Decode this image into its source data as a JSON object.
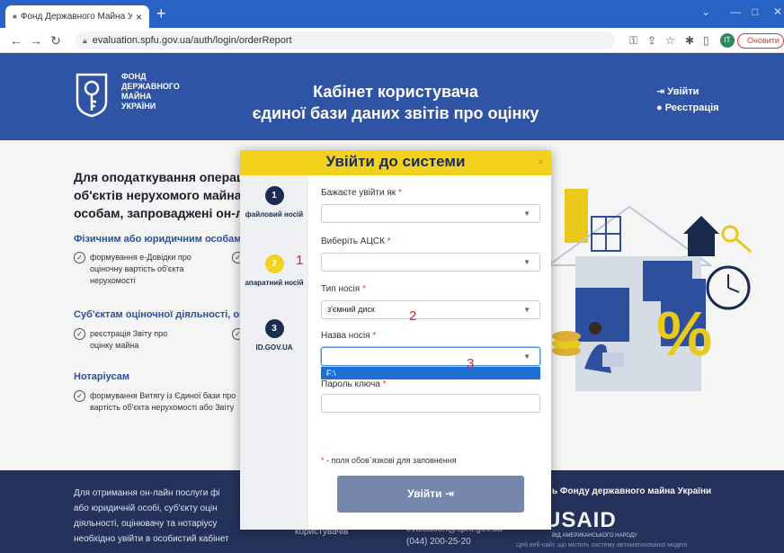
{
  "browser": {
    "tab_title": "Фонд Державного Майна Украї",
    "url": "evaluation.spfu.gov.ua/auth/login/orderReport",
    "profile_initial": "IT",
    "update_label": "Оновити"
  },
  "header": {
    "logo_lines": [
      "ФОНД",
      "ДЕРЖАВНОГО",
      "МАЙНА",
      "УКРАЇНИ"
    ],
    "title_line1": "Кабінет користувача",
    "title_line2": "єдиної бази даних звітів про оцінку",
    "login_label": "Увійти",
    "register_label": "Реєстрація"
  },
  "main": {
    "heading_line1": "Для оподаткування операці",
    "heading_line2": "об'єктів нерухомого майна,",
    "heading_line3": "особам, запроваджені он-ла",
    "section1_title": "Фізичним або юридичним особам",
    "section1_item1": [
      "формування е-Довідки про",
      "оціночну вартість об'єкта",
      "нерухомості"
    ],
    "section2_title": "Суб'єктам оціночної діяльності, оці",
    "section2_item1": [
      "реєстрація Звіту про",
      "оцінку майна"
    ],
    "section3_title": "Нотаріусам",
    "section3_item1": [
      "формування Витягу із Єдиної бази про",
      "вартість об'єкта нерухомості або Звіту"
    ]
  },
  "footer": {
    "text_lines": [
      "Для отримання он-лайн послуги фі",
      "або юридичній особі, суб'єкту оцін",
      "діяльності, оцінювачу та нотаріусу",
      "необхідно увійти в особистий кабінет"
    ],
    "mid_text": "користувачів",
    "email": "evaluation@spfu.gov.ua",
    "phone": "(044) 200-25-20",
    "right_title": "ь Фонду державного майна України",
    "usaid": "USAID",
    "usaid_sub": "ВІД АМЕРИКАНСЬКОГО НАРОДУ",
    "note": "Цей веб-сайт, що містить систему автоматизованої моделі"
  },
  "modal": {
    "title": "Увійти до системи",
    "close": "×",
    "steps": [
      {
        "num": "1",
        "label": "файловий носій"
      },
      {
        "num": "2",
        "label": "апаратний носій"
      },
      {
        "num": "3",
        "label": "ID.GOV.UA"
      }
    ],
    "fields": {
      "login_as_label": "Бажаєте увійти як",
      "login_as_value": "",
      "acsk_label": "Виберіть АЦСК",
      "acsk_value": "",
      "media_type_label": "Тип носія",
      "media_type_value": "з'ємний диск",
      "media_name_label": "Назва носія",
      "media_name_value": "",
      "media_name_option": "F:\\",
      "key_password_label": "Пароль ключа"
    },
    "required_mark": "*",
    "required_note": "- поля обов`язкові для заповнення",
    "submit_label": "Увійти"
  },
  "annotations": [
    "1",
    "2",
    "3"
  ],
  "colors": {
    "brand_blue": "#2f53a5",
    "accent_yellow": "#f3d21e",
    "footer_navy": "#26355f",
    "annotation_red": "#e0242a"
  }
}
